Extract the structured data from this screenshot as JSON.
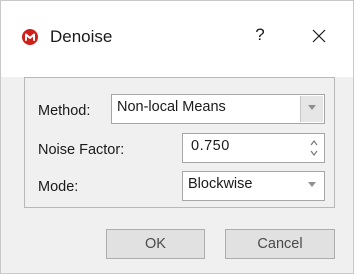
{
  "window": {
    "title": "Denoise",
    "help_label": "?",
    "app_icon": "app-logo-icon",
    "close_icon": "close-icon"
  },
  "form": {
    "method_label": "Method:",
    "method_value": "Non-local Means",
    "noise_factor_label": "Noise Factor:",
    "noise_factor_value": "0.750",
    "mode_label": "Mode:",
    "mode_value": "Blockwise"
  },
  "buttons": {
    "ok": "OK",
    "cancel": "Cancel"
  },
  "colors": {
    "dialog_bg": "#f0f0f0",
    "titlebar_bg": "#ffffff",
    "accent_icon": "#d0201a"
  }
}
